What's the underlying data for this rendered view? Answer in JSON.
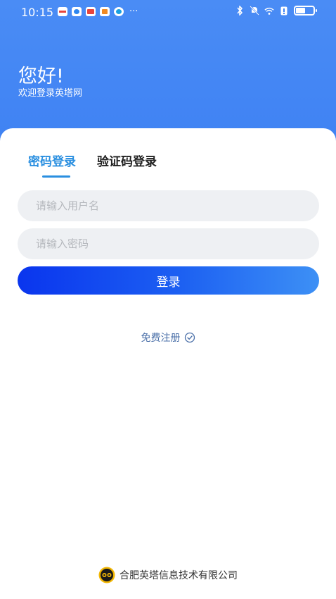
{
  "status_bar": {
    "time": "10:15",
    "more": "···",
    "notification_icons": [
      "red-app-icon",
      "blue-chat-icon",
      "mail-app-icon",
      "calendar-app-icon",
      "browser-globe-icon"
    ],
    "right_icons": [
      "bluetooth-icon",
      "mute-icon",
      "wifi-icon",
      "sim-icon",
      "battery-icon"
    ]
  },
  "header": {
    "greeting": "您好!",
    "welcome": "欢迎登录英塔网",
    "background_color": "#4a8cf5"
  },
  "tabs": [
    {
      "label": "密码登录",
      "active": true
    },
    {
      "label": "验证码登录",
      "active": false
    }
  ],
  "form": {
    "username_placeholder": "请输入用户名",
    "password_placeholder": "请输入密码",
    "login_label": "登录"
  },
  "register": {
    "label": "免费注册"
  },
  "footer": {
    "company": "合肥英塔信息技术有限公司"
  },
  "colors": {
    "accent": "#2a8fe0",
    "button_start": "#0a35ee",
    "button_end": "#3d90f5",
    "input_bg": "#eef0f3"
  }
}
